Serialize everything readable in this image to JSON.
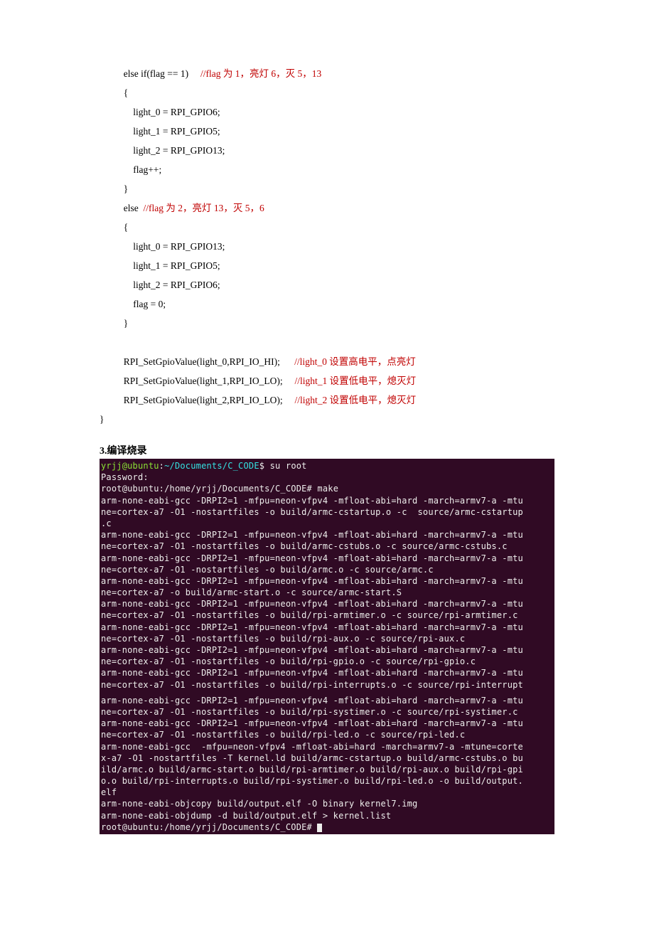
{
  "code": {
    "l1a": "          else if(flag == 1)     ",
    "l1b": "//flag 为 1，亮灯 6，灭 5，13",
    "l2": "          {",
    "l3": "              light_0 = RPI_GPIO6;",
    "l4": "              light_1 = RPI_GPIO5;",
    "l5": "              light_2 = RPI_GPIO13;",
    "l6": "              flag++;",
    "l7": "          }",
    "l8a": "          else  ",
    "l8b": "//flag 为 2，亮灯 13，灭 5，6",
    "l9": "          {",
    "l10": "              light_0 = RPI_GPIO13;",
    "l11": "              light_1 = RPI_GPIO5;",
    "l12": "              light_2 = RPI_GPIO6;",
    "l13": "              flag = 0;",
    "l14": "          }",
    "blank1": "",
    "l15a": "          RPI_SetGpioValue(light_0,RPI_IO_HI);      ",
    "l15b": "//light_0 设置高电平，点亮灯",
    "l16a": "          RPI_SetGpioValue(light_1,RPI_IO_LO);     ",
    "l16b": "//light_1 设置低电平，熄灭灯",
    "l17a": "          RPI_SetGpioValue(light_2,RPI_IO_LO);     ",
    "l17b": "//light_2 设置低电平，熄灭灯",
    "l18": "}"
  },
  "heading": "3.编译烧录",
  "term": {
    "l1a": "yrjj@ubuntu",
    "l1b": ":",
    "l1c": "~/Documents/C_CODE",
    "l1d": "$ su root",
    "l2": "Password: ",
    "l3a": "root@ubuntu:/home/yrjj/Documents/C_CODE# ",
    "l3b": "make",
    "l4": "arm-none-eabi-gcc -DRPI2=1 -mfpu=neon-vfpv4 -mfloat-abi=hard -march=armv7-a -mtu",
    "l5": "ne=cortex-a7 -O1 -nostartfiles -o build/armc-cstartup.o -c  source/armc-cstartup",
    "l6": ".c",
    "l7": "arm-none-eabi-gcc -DRPI2=1 -mfpu=neon-vfpv4 -mfloat-abi=hard -march=armv7-a -mtu",
    "l8": "ne=cortex-a7 -O1 -nostartfiles -o build/armc-cstubs.o -c source/armc-cstubs.c",
    "l9": "arm-none-eabi-gcc -DRPI2=1 -mfpu=neon-vfpv4 -mfloat-abi=hard -march=armv7-a -mtu",
    "l10": "ne=cortex-a7 -O1 -nostartfiles -o build/armc.o -c source/armc.c",
    "l11": "arm-none-eabi-gcc -DRPI2=1 -mfpu=neon-vfpv4 -mfloat-abi=hard -march=armv7-a -mtu",
    "l12": "ne=cortex-a7 -o build/armc-start.o -c source/armc-start.S",
    "l13": "arm-none-eabi-gcc -DRPI2=1 -mfpu=neon-vfpv4 -mfloat-abi=hard -march=armv7-a -mtu",
    "l14": "ne=cortex-a7 -O1 -nostartfiles -o build/rpi-armtimer.o -c source/rpi-armtimer.c",
    "l15": "arm-none-eabi-gcc -DRPI2=1 -mfpu=neon-vfpv4 -mfloat-abi=hard -march=armv7-a -mtu",
    "l16": "ne=cortex-a7 -O1 -nostartfiles -o build/rpi-aux.o -c source/rpi-aux.c",
    "l17": "arm-none-eabi-gcc -DRPI2=1 -mfpu=neon-vfpv4 -mfloat-abi=hard -march=armv7-a -mtu",
    "l18": "ne=cortex-a7 -O1 -nostartfiles -o build/rpi-gpio.o -c source/rpi-gpio.c",
    "l19": "arm-none-eabi-gcc -DRPI2=1 -mfpu=neon-vfpv4 -mfloat-abi=hard -march=armv7-a -mtu",
    "l20": "ne=cortex-a7 -O1 -nostartfiles -o build/rpi-interrupts.o -c source/rpi-interrupt",
    "l21": "arm-none-eabi-gcc -DRPI2=1 -mfpu=neon-vfpv4 -mfloat-abi=hard -march=armv7-a -mtu",
    "l22": "ne=cortex-a7 -O1 -nostartfiles -o build/rpi-systimer.o -c source/rpi-systimer.c",
    "l23": "arm-none-eabi-gcc -DRPI2=1 -mfpu=neon-vfpv4 -mfloat-abi=hard -march=armv7-a -mtu",
    "l24": "ne=cortex-a7 -O1 -nostartfiles -o build/rpi-led.o -c source/rpi-led.c",
    "l25": "arm-none-eabi-gcc  -mfpu=neon-vfpv4 -mfloat-abi=hard -march=armv7-a -mtune=corte",
    "l26": "x-a7 -O1 -nostartfiles -T kernel.ld build/armc-cstartup.o build/armc-cstubs.o bu",
    "l27": "ild/armc.o build/armc-start.o build/rpi-armtimer.o build/rpi-aux.o build/rpi-gpi",
    "l28": "o.o build/rpi-interrupts.o build/rpi-systimer.o build/rpi-led.o -o build/output.",
    "l29": "elf",
    "l30": "arm-none-eabi-objcopy build/output.elf -O binary kernel7.img",
    "l31": "arm-none-eabi-objdump -d build/output.elf > kernel.list",
    "l32": "root@ubuntu:/home/yrjj/Documents/C_CODE# "
  }
}
